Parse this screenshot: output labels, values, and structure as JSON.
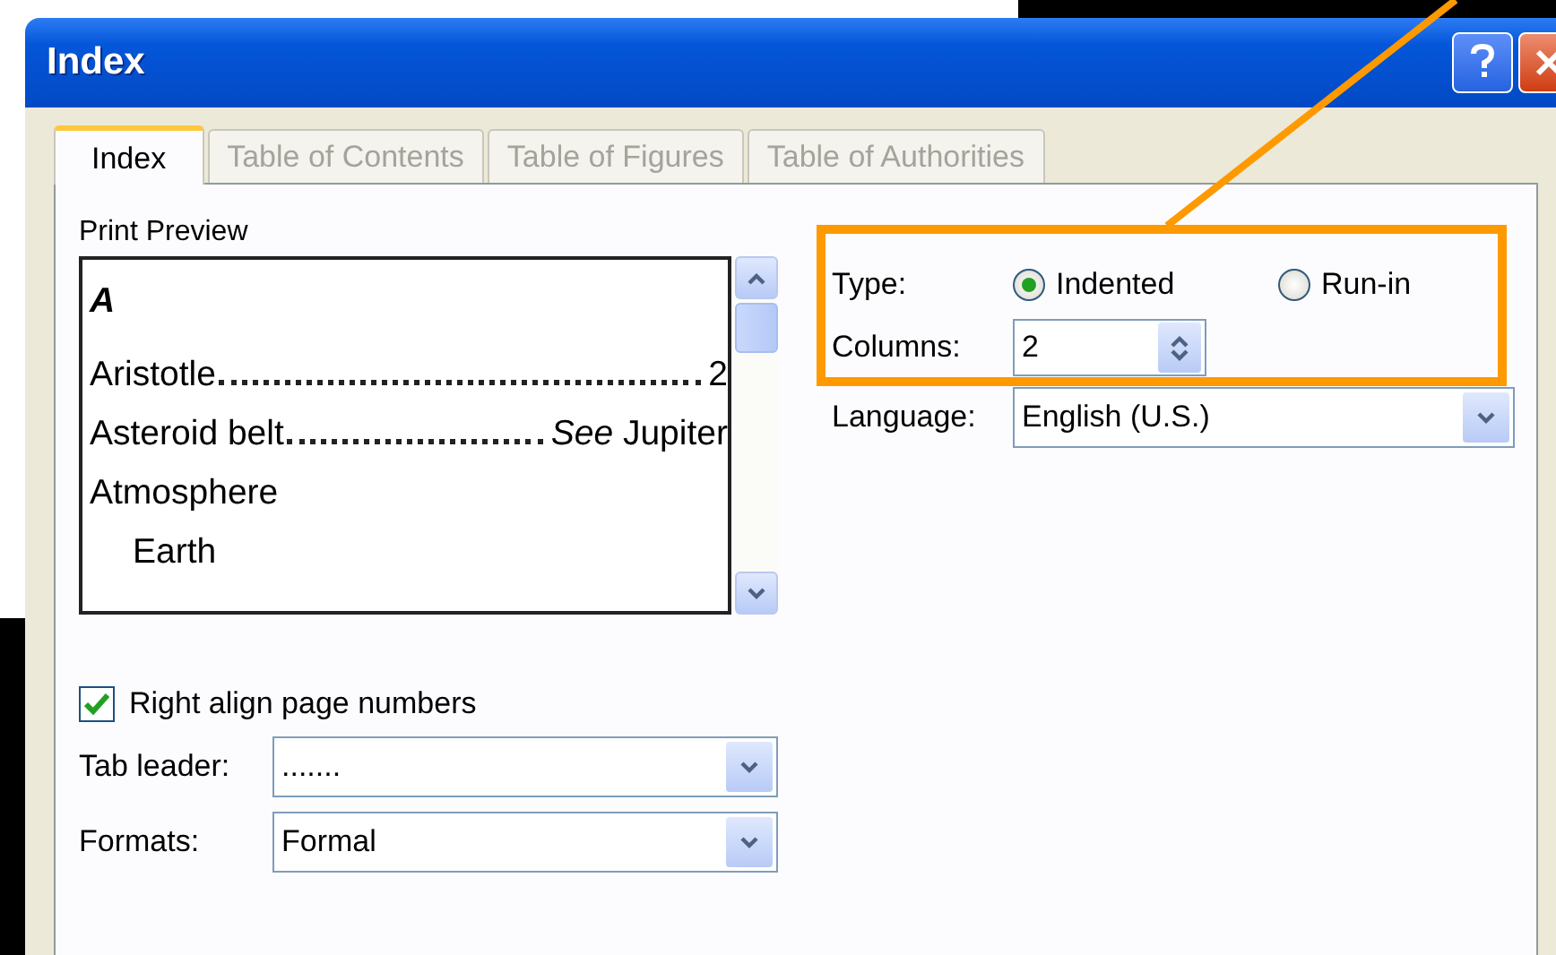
{
  "window": {
    "title": "Index"
  },
  "tabs": [
    {
      "label": "Index",
      "selected": true
    },
    {
      "label": "Table of Contents",
      "selected": false
    },
    {
      "label": "Table of Figures",
      "selected": false
    },
    {
      "label": "Table of Authorities",
      "selected": false
    }
  ],
  "preview": {
    "label": "Print Preview",
    "heading": "A",
    "entries": [
      {
        "text": "Aristotle",
        "page": "2"
      },
      {
        "text": "Asteroid belt",
        "page": "*See* Jupiter"
      },
      {
        "text": "Atmosphere",
        "children": [
          {
            "text": "Earth"
          }
        ]
      }
    ]
  },
  "right_align_page_numbers": {
    "label": "Right align page numbers",
    "checked": true
  },
  "tab_leader": {
    "label": "Tab leader:",
    "value": "......."
  },
  "formats": {
    "label": "Formats:",
    "value": "Formal"
  },
  "type": {
    "label": "Type:",
    "options": [
      {
        "label": "Indented",
        "selected": true
      },
      {
        "label": "Run-in",
        "selected": false
      }
    ]
  },
  "columns": {
    "label": "Columns:",
    "value": "2"
  },
  "language": {
    "label": "Language:",
    "value": "English (U.S.)"
  }
}
